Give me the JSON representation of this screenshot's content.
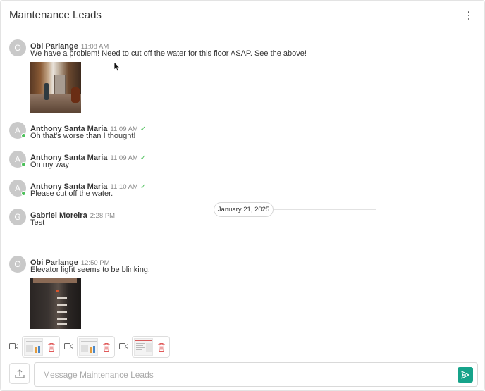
{
  "header": {
    "title": "Maintenance Leads",
    "menu_icon": "more-vertical-icon"
  },
  "messages": [
    {
      "initial": "O",
      "author": "Obi Parlange",
      "time": "11:08 AM",
      "check": "",
      "text": "We have a problem! Need to cut off the water for this floor ASAP. See the above!"
    },
    {
      "initial": "A",
      "author": "Anthony Santa Maria",
      "time": "11:09 AM",
      "check": "✓",
      "text": "Oh that's worse than I thought!"
    },
    {
      "initial": "A",
      "author": "Anthony Santa Maria",
      "time": "11:09 AM",
      "check": "✓",
      "text": "On my way"
    },
    {
      "initial": "A",
      "author": "Anthony Santa Maria",
      "time": "11:10 AM",
      "check": "✓",
      "text": "Please cut off the water."
    },
    {
      "initial": "G",
      "author": "Gabriel Moreira",
      "time": "2:28 PM",
      "check": "",
      "text": "Test"
    },
    {
      "initial": "O",
      "author": "Obi Parlange",
      "time": "12:50 PM",
      "check": "",
      "text": "Elevator light seems to be blinking."
    }
  ],
  "date_divider": "January 21, 2025",
  "attachments": [
    {
      "type": "video",
      "icon": "video-icon",
      "delete_icon": "trash-icon"
    },
    {
      "type": "video",
      "icon": "video-icon",
      "delete_icon": "trash-icon"
    },
    {
      "type": "video",
      "icon": "video-icon",
      "delete_icon": "trash-icon"
    }
  ],
  "composer": {
    "placeholder": "Message Maintenance Leads",
    "value": "",
    "upload_icon": "upload-icon",
    "send_icon": "send-icon"
  },
  "colors": {
    "accent": "#16a38a",
    "online": "#4cc05a",
    "trash": "#e05a5a"
  }
}
